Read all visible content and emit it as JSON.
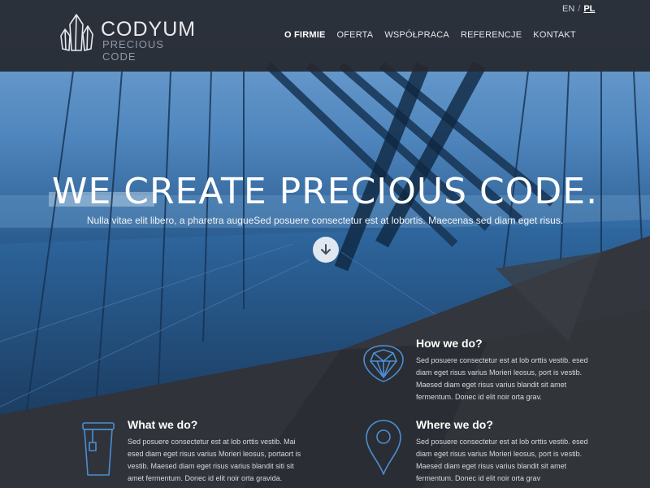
{
  "header": {
    "logo_title": "CODYUM",
    "logo_subtitle": "PRECIOUS CODE",
    "languages": {
      "en": "EN",
      "separator": "/",
      "pl": "PL"
    },
    "nav": [
      {
        "label": "O FIRMIE"
      },
      {
        "label": "OFERTA"
      },
      {
        "label": "WSPÓŁPRACA"
      },
      {
        "label": "REFERENCJE"
      },
      {
        "label": "KONTAKT"
      }
    ]
  },
  "hero": {
    "headline": "WE CREATE PRECIOUS CODE.",
    "subline": "Nulla vitae elit libero, a pharetra augueSed posuere consectetur est at lobortis. Maecenas sed diam eget risus.",
    "scroll_icon": "arrow-down-icon"
  },
  "features": {
    "how": {
      "title": "How we do?",
      "text": "Sed posuere consectetur est at lob orttis vestib. esed diam eget risus varius  Morieri leosus, port is vestib.  Maesed diam eget risus varius blandit sit amet fermentum. Donec id elit noir orta grav.",
      "icon": "diamond-icon"
    },
    "what": {
      "title": "What we do?",
      "text": "Sed posuere consectetur est at lob orttis vestib. Mai esed diam eget risus varius  Morieri leosus, portaort is vestib.  Maesed diam eget risus varius blandit siti sit amet fermentum. Donec id elit noir orta gravida.",
      "icon": "coffee-cup-icon"
    },
    "where": {
      "title": "Where we do?",
      "text": "Sed posuere consectetur est at lob orttis vestib. esed diam eget risus varius  Morieri leosus, port is vestib.  Maesed diam eget risus varius blandit sit amet fermentum. Donec id elit noir orta grav",
      "icon": "map-pin-icon"
    }
  },
  "colors": {
    "header_bg": "#26282e",
    "accent_blue": "#4a8fd4",
    "dark_bg": "#2a2d33"
  }
}
